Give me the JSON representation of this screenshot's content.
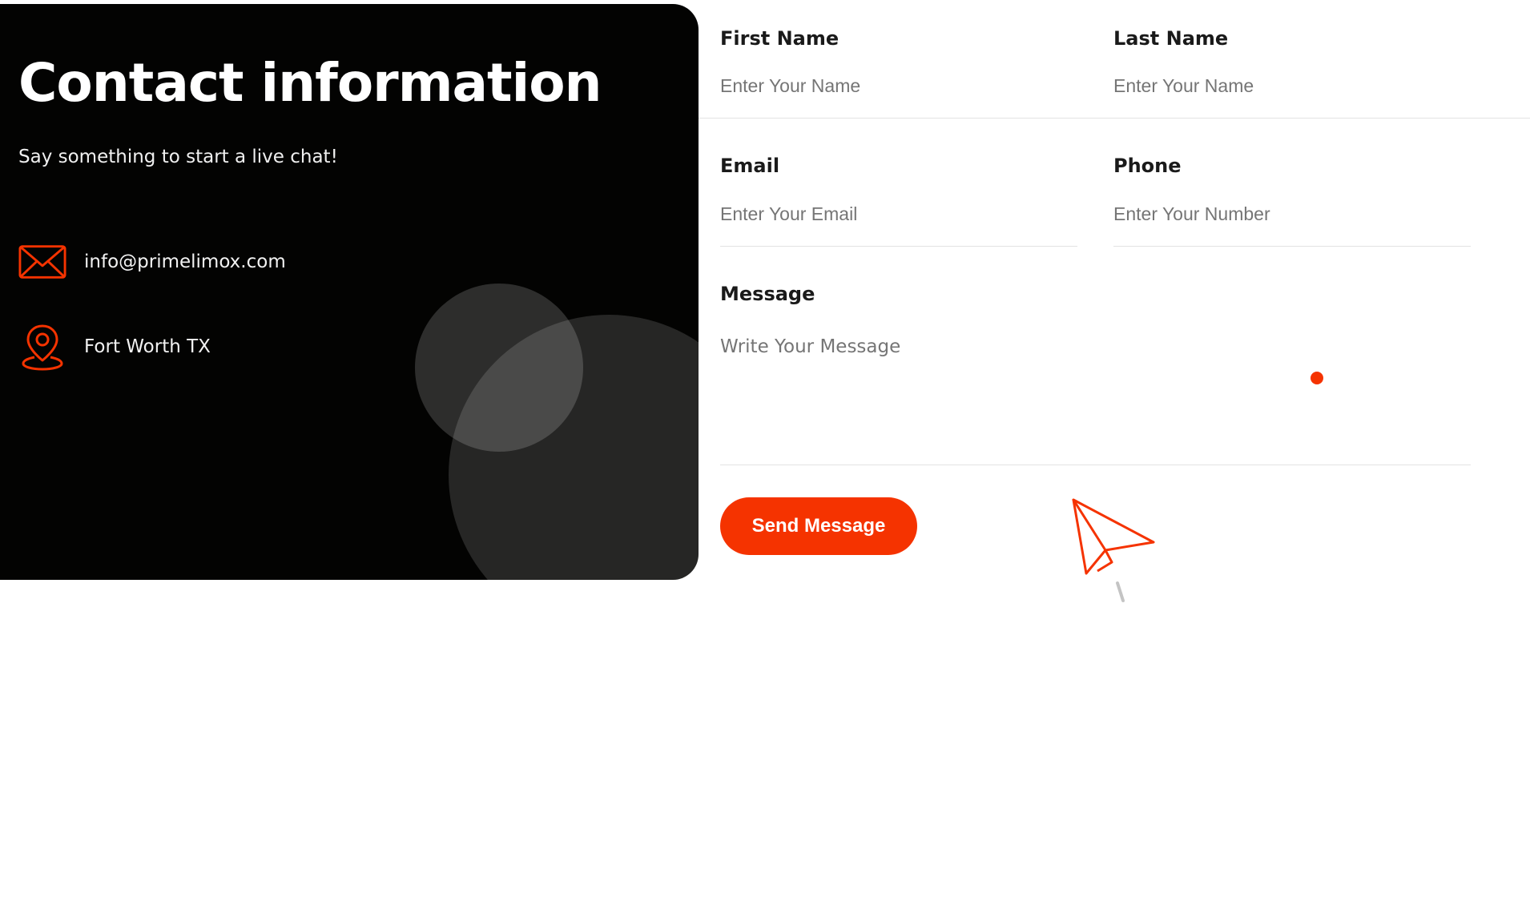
{
  "contact": {
    "title": "Contact information",
    "subtitle": "Say something to start a live chat!",
    "email": "info@primelimox.com",
    "location": "Fort Worth TX",
    "icons": {
      "email": "envelope-icon",
      "location": "map-pin-icon"
    }
  },
  "form": {
    "first_name": {
      "label": "First Name",
      "placeholder": "Enter Your Name"
    },
    "last_name": {
      "label": "Last Name",
      "placeholder": "Enter Your Name"
    },
    "email": {
      "label": "Email",
      "placeholder": "Enter Your Email"
    },
    "phone": {
      "label": "Phone",
      "placeholder": "Enter Your Number"
    },
    "message": {
      "label": "Message",
      "placeholder": "Write Your Message"
    },
    "submit_label": "Send Message",
    "decoration_icon": "paper-plane-icon"
  },
  "colors": {
    "accent": "#f53300",
    "card_background": "#030302",
    "text_dark": "#1a1a1a"
  }
}
